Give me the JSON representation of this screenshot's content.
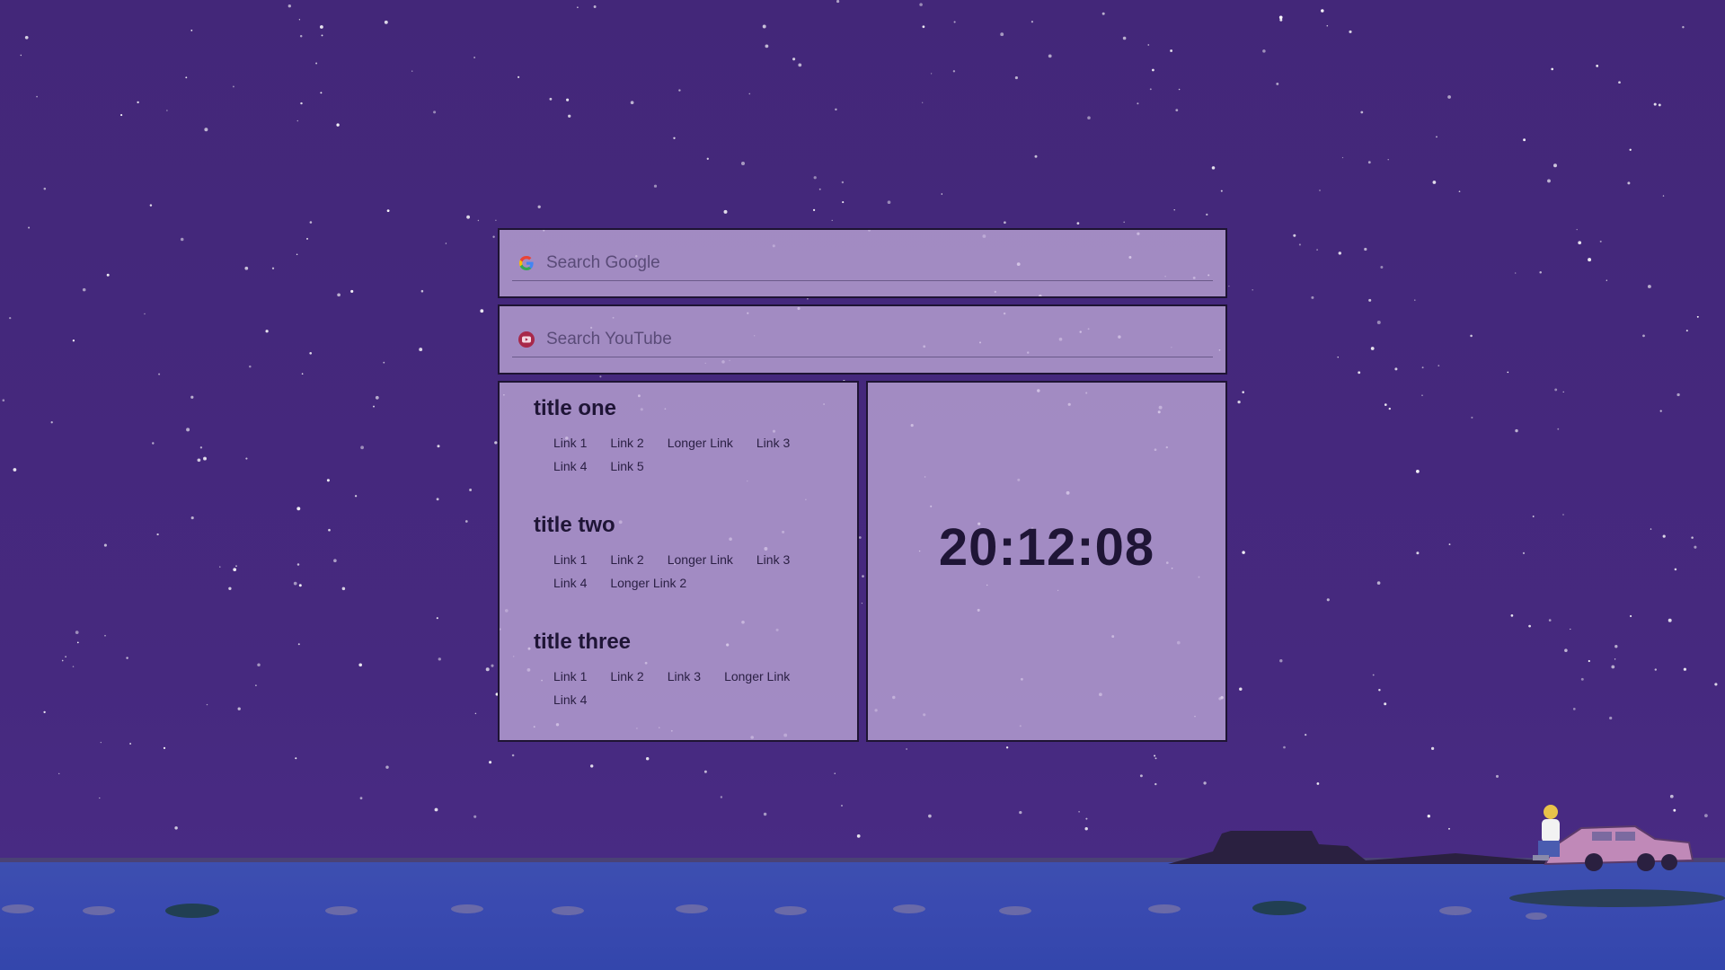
{
  "search": {
    "google_placeholder": "Search Google",
    "youtube_placeholder": "Search YouTube",
    "google_icon": "google-icon",
    "youtube_icon": "youtube-icon"
  },
  "sections": [
    {
      "title": "title one",
      "rows": [
        [
          "Link 1",
          "Link 2",
          "Longer Link",
          "Link 3"
        ],
        [
          "Link 4",
          "Link 5"
        ]
      ]
    },
    {
      "title": "title two",
      "rows": [
        [
          "Link 1",
          "Link 2",
          "Longer Link",
          "Link 3"
        ],
        [
          "Link 4",
          "Longer Link 2"
        ]
      ]
    },
    {
      "title": "title three",
      "rows": [
        [
          "Link 1",
          "Link 2",
          "Link 3",
          "Longer Link"
        ],
        [
          "Link 4"
        ]
      ]
    }
  ],
  "clock": {
    "time": "20:12:08"
  },
  "colors": {
    "background": "#44287e",
    "card": "#c6b2de",
    "text": "#1f1536"
  }
}
